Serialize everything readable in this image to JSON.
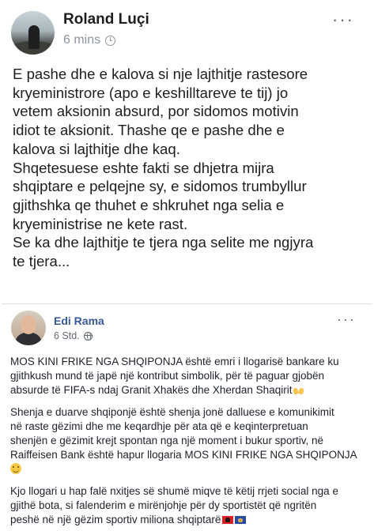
{
  "post": {
    "author": "Roland Luçi",
    "time": "6 mins",
    "time_icon": "clock-icon",
    "more_icon": "more-options-icon",
    "more_label": "···",
    "text_lines": [
      "E pashe dhe e kalova si nje lajthitje rastesore",
      "kryeministrore (apo e keshilltareve te tij) jo",
      "vetem aksionin absurd, por sidomos motivin",
      "idiot te aksionit. Thashe qe e pashe dhe e",
      "kalova si lajthitje dhe kaq.",
      "Shqetesuese eshte fakti se dhjetra mijra",
      "shqiptare e pelqejne sy, e sidomos trumbyllur",
      "gjithshka qe thuhet e shkruhet nga selia e",
      "kryeministrise ne kete rast.",
      "Se ka dhe lajthitje te tjera nga selite me ngjyra",
      "te tjera..."
    ]
  },
  "shared": {
    "author": "Edi Rama",
    "time": "6 Std.",
    "privacy_icon": "globe-icon",
    "more_label": "···",
    "paragraphs": [
      {
        "lines": [
          "MOS KINI FRIKE NGA SHQIPONJA është emri i llogarisë bankare ku",
          "gjithkush mund të japë një kontribut simbolik, për të paguar gjobën",
          "absurde të FIFA-s ndaj Granit Xhakës dhe Xherdan Shaqirit"
        ],
        "trailing_icon": "praying-hands-emoji-icon"
      },
      {
        "lines": [
          "Shenja e duarve shqiponjë është shenja jonë dalluese e komunikimit",
          "në raste gëzimi dhe me keqardhje për ata që e keqinterpretuan",
          "shenjën e gëzimit krejt spontan nga një moment i bukur sportiv, në",
          "Raiffeisen Bank është hapur llogaria MOS KINI FRIKE NGA SHQIPONJA"
        ],
        "trailing_icon": "smiling-face-emoji-icon"
      },
      {
        "lines": [
          "Kjo llogari u hap falë nxitjes së shumë miqve të këtij rrjeti social nga e",
          "gjithë bota, si falenderim e mirënjohje për dy sportistët që ngritën",
          "peshë në një gëzim sportiv miliona shqiptarë"
        ],
        "trailing_icon": "flags-albania-kosovo-icon"
      }
    ]
  },
  "colors": {
    "author_name": "#1c1e21",
    "meta_gray": "#8d949e",
    "shared_author_link": "#365899"
  }
}
